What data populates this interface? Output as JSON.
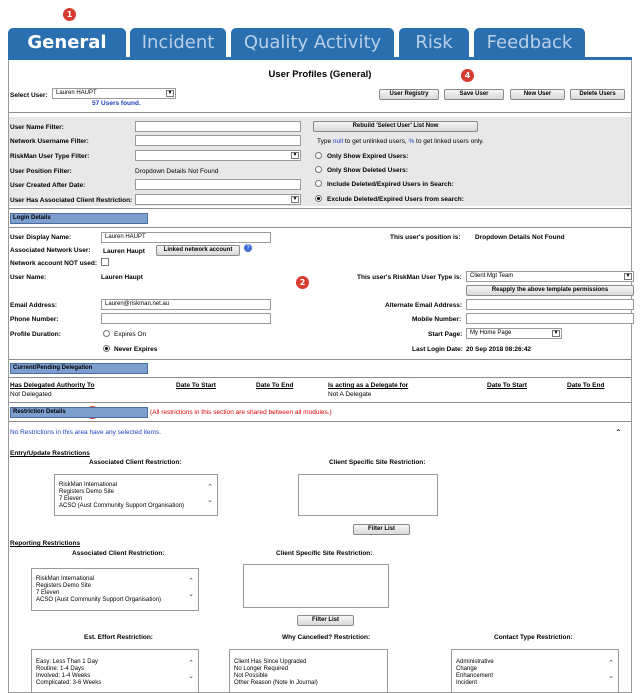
{
  "tabs": [
    {
      "label": "General",
      "active": true
    },
    {
      "label": "Incident",
      "active": false
    },
    {
      "label": "Quality Activity",
      "active": false
    },
    {
      "label": "Risk",
      "active": false
    },
    {
      "label": "Feedback",
      "active": false
    }
  ],
  "badges": [
    "1",
    "2",
    "3",
    "4"
  ],
  "page_title": "User Profiles (General)",
  "select_user": {
    "label": "Select User:",
    "value": "Lauren HAUPT",
    "found": "57 Users found."
  },
  "toolbar": {
    "user_registry": "User Registry",
    "save_user": "Save User",
    "new_user": "New User",
    "delete_users": "Delete Users"
  },
  "filters": {
    "user_name": "User Name Filter:",
    "network_username": "Network Username Filter:",
    "user_type": "RiskMan User Type Filter:",
    "user_position": "User Position Filter:",
    "user_position_value": "Dropdown Details Not Found",
    "created_after": "User Created After Date:",
    "client_restriction": "User Has Associated Client Restriction:",
    "rebuild_button": "Rebuild 'Select User' List Now",
    "hint_pre": "Type",
    "hint_null": "null",
    "hint_mid": "to get unlinked users,",
    "hint_pct": "%",
    "hint_post": "to get linked users only.",
    "opt_expired": "Only Show Expired Users:",
    "opt_deleted": "Only Show Deleted Users:",
    "opt_include": "Include Deleted/Expired Users in Search:",
    "opt_exclude": "Exclude Deleted/Expired Users from search:"
  },
  "login": {
    "header": "Login Details",
    "display_name_label": "User Display Name:",
    "display_name_value": "Lauren HAUPT",
    "position_label": "This user's position is:",
    "position_value": "Dropdown Details Not Found",
    "assoc_network_label": "Associated Network User:",
    "assoc_network_value": "Lauren Haupt",
    "linked_button": "Linked network account",
    "help_icon": "?",
    "not_used_label": "Network account NOT used:",
    "username_label": "User Name:",
    "username_value": "Lauren Haupt",
    "user_type_label": "This user's RiskMan User Type is:",
    "user_type_value": "Client Mgt Team",
    "reapply_button": "Reapply the above template permissions",
    "email_label": "Email Address:",
    "email_value": "Lauren@riskman.net.au",
    "alt_email_label": "Alternate Email Address:",
    "phone_label": "Phone Number:",
    "mobile_label": "Mobile Number:",
    "profile_duration_label": "Profile Duration:",
    "expires_on": "Expires On",
    "never_expires": "Never Expires",
    "start_page_label": "Start Page:",
    "start_page_value": "My Home Page",
    "last_login_label": "Last Login Date:",
    "last_login_value": "20 Sep 2018 08:26:42"
  },
  "delegation": {
    "header": "Current/Pending Delegation",
    "col1": "Has Delegated Authority To",
    "col2": "Date To Start",
    "col3": "Date To End",
    "col4": "Is acting as a Delegate for",
    "col5": "Date To Start",
    "col6": "Date To End",
    "val1": "Not Delegated",
    "val4": "Not A Delegate"
  },
  "restriction": {
    "header": "Restriction Details",
    "note": "(All restrictions in this section are shared between all modules.)",
    "none_selected": "No Restrictions in this area have any selected items.",
    "entry_update": "Entry/Update Restrictions",
    "assoc_client": "Associated Client Restriction:",
    "client_site": "Client Specific Site Restriction:",
    "client_items": [
      "RiskMan International",
      "Registers Demo Site",
      "7 Eleven",
      "ACSO (Aust Community Support Organisation)"
    ],
    "filter_list": "Filter List",
    "reporting": "Reporting Restrictions",
    "est_effort": "Est. Effort Restriction:",
    "why_cancelled": "Why Cancelled? Restriction:",
    "contact_type": "Contact Type Restriction:",
    "effort_items": [
      "Easy: Less Than 1 Day",
      "Routine: 1-4 Days",
      "Involved: 1-4 Weeks",
      "Complicated: 3-6 Weeks"
    ],
    "cancel_items": [
      "Client Has Since Upgraded",
      "No Longer Required",
      "Not Possible",
      "Other Reason (Note In Journal)"
    ],
    "contact_items": [
      "Administrative",
      "Change",
      "Enhancement",
      "Incident"
    ]
  },
  "colors": {
    "tab_blue": "#2a6fb0",
    "badge_red": "#d83b2f",
    "section_blue": "#7d9fcf"
  }
}
